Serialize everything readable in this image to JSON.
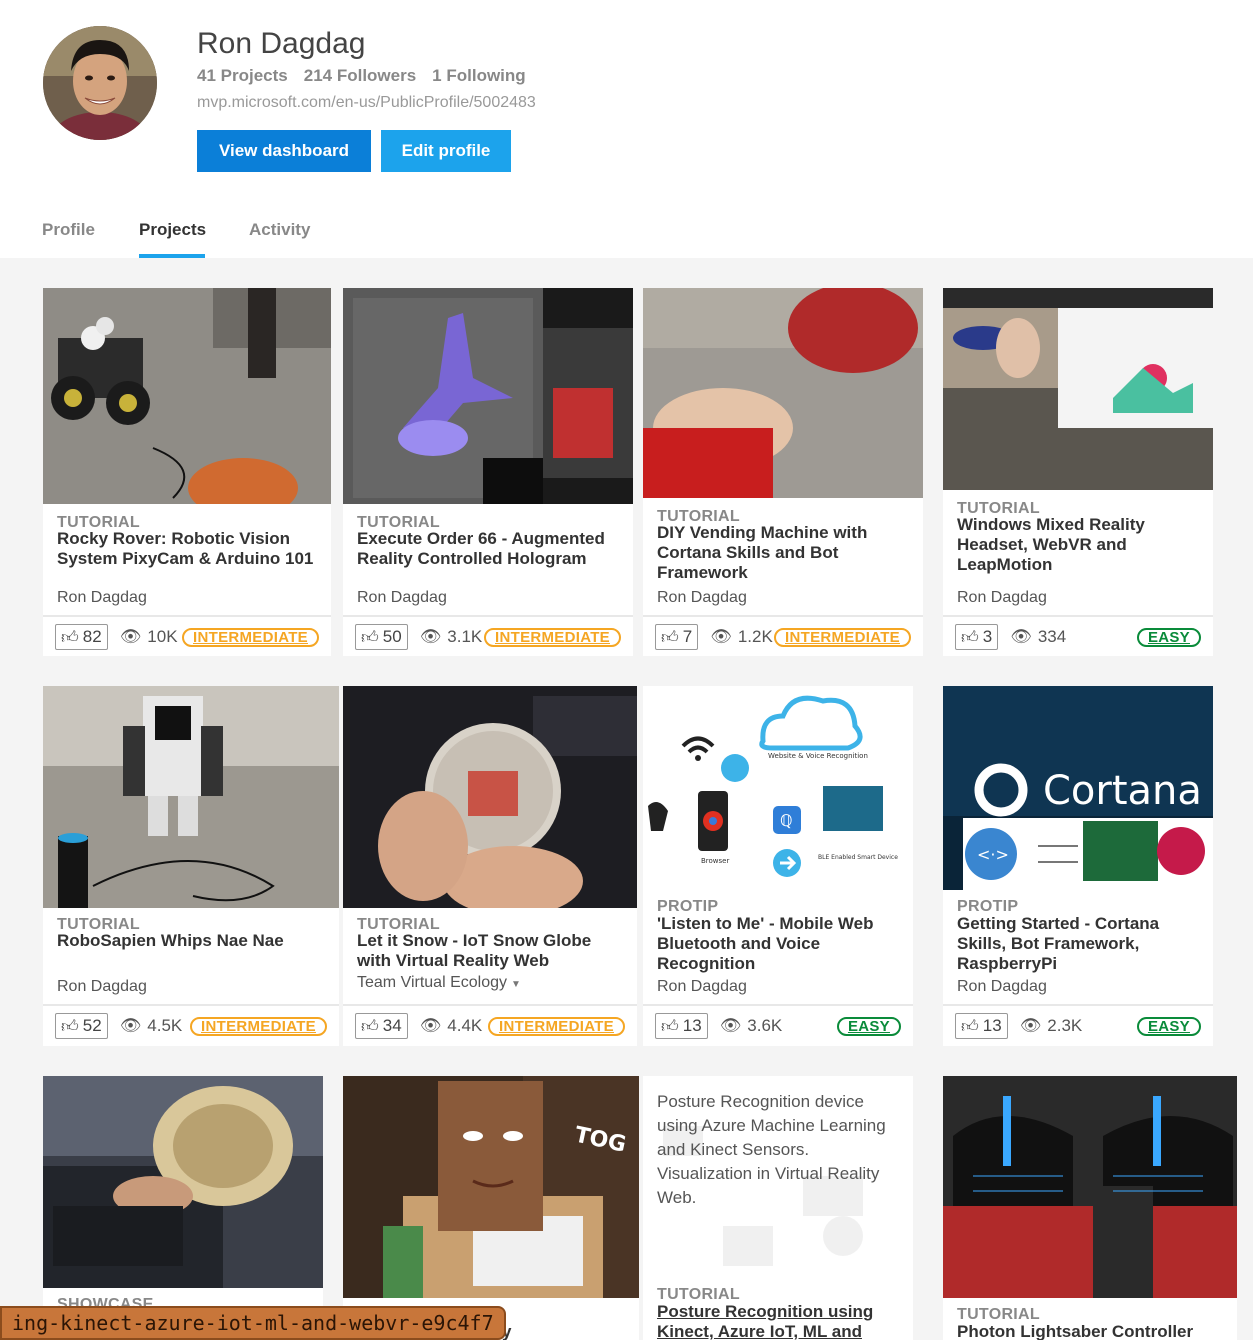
{
  "profile": {
    "name": "Ron Dagdag",
    "projects": "41 Projects",
    "followers": "214 Followers",
    "following": "1 Following",
    "url": "mvp.microsoft.com/en-us/PublicProfile/5002483",
    "view_dashboard": "View dashboard",
    "edit_profile": "Edit profile"
  },
  "tabs": [
    {
      "label": "Profile"
    },
    {
      "label": "Projects"
    },
    {
      "label": "Activity"
    }
  ],
  "cards": [
    {
      "type": "TUTORIAL",
      "title": "Rocky Rover: Robotic Vision System PixyCam & Arduino 101",
      "author": "Ron Dagdag",
      "likes": "82",
      "views": "10K",
      "difficulty": "INTERMEDIATE"
    },
    {
      "type": "TUTORIAL",
      "title": "Execute Order 66 - Augmented Reality Controlled Hologram",
      "author": "Ron Dagdag",
      "likes": "50",
      "views": "3.1K",
      "difficulty": "INTERMEDIATE"
    },
    {
      "type": "TUTORIAL",
      "title": "DIY Vending Machine with Cortana Skills and Bot Framework",
      "author": "Ron Dagdag",
      "likes": "7",
      "views": "1.2K",
      "difficulty": "INTERMEDIATE"
    },
    {
      "type": "TUTORIAL",
      "title": "Windows Mixed Reality Headset, WebVR and LeapMotion",
      "author": "Ron Dagdag",
      "likes": "3",
      "views": "334",
      "difficulty": "EASY"
    },
    {
      "type": "TUTORIAL",
      "title": "RoboSapien Whips Nae Nae",
      "author": "Ron Dagdag",
      "likes": "52",
      "views": "4.5K",
      "difficulty": "INTERMEDIATE"
    },
    {
      "type": "TUTORIAL",
      "title": "Let it Snow - IoT Snow Globe with Virtual Reality Web",
      "author": "Team Virtual Ecology",
      "likes": "34",
      "views": "4.4K",
      "difficulty": "INTERMEDIATE"
    },
    {
      "type": "PROTIP",
      "title": "'Listen to Me' - Mobile Web Bluetooth and Voice Recognition",
      "author": "Ron Dagdag",
      "likes": "13",
      "views": "3.6K",
      "difficulty": "EASY"
    },
    {
      "type": "PROTIP",
      "title": "Getting Started - Cortana Skills, Bot Framework, RaspberryPi",
      "author": "Ron Dagdag",
      "likes": "13",
      "views": "2.3K",
      "difficulty": "EASY"
    },
    {
      "type": "SHOWCASE"
    },
    {
      "title_fragment": "eality"
    },
    {
      "type": "TUTORIAL",
      "title": "Posture Recognition using Kinect, Azure IoT, ML and",
      "description": "Posture Recognition device using Azure Machine Learning and Kinect Sensors. Visualization in Virtual Reality Web."
    },
    {
      "type": "TUTORIAL",
      "title": "Photon Lightsaber Controller"
    }
  ],
  "thumb_text": {
    "website_voice": "Website & Voice Recognition",
    "browser": "Browser",
    "ble": "BLE Enabled Smart Device",
    "cortana": "Cortana",
    "snow_toggle": "TOG"
  },
  "status_url": "ing-kinect-azure-iot-ml-and-webvr-e9c4f7",
  "colors": {
    "primary": "#0b7fd8",
    "secondary": "#1ca3ec",
    "intermediate": "#f5a623",
    "easy": "#0a8b3a"
  }
}
